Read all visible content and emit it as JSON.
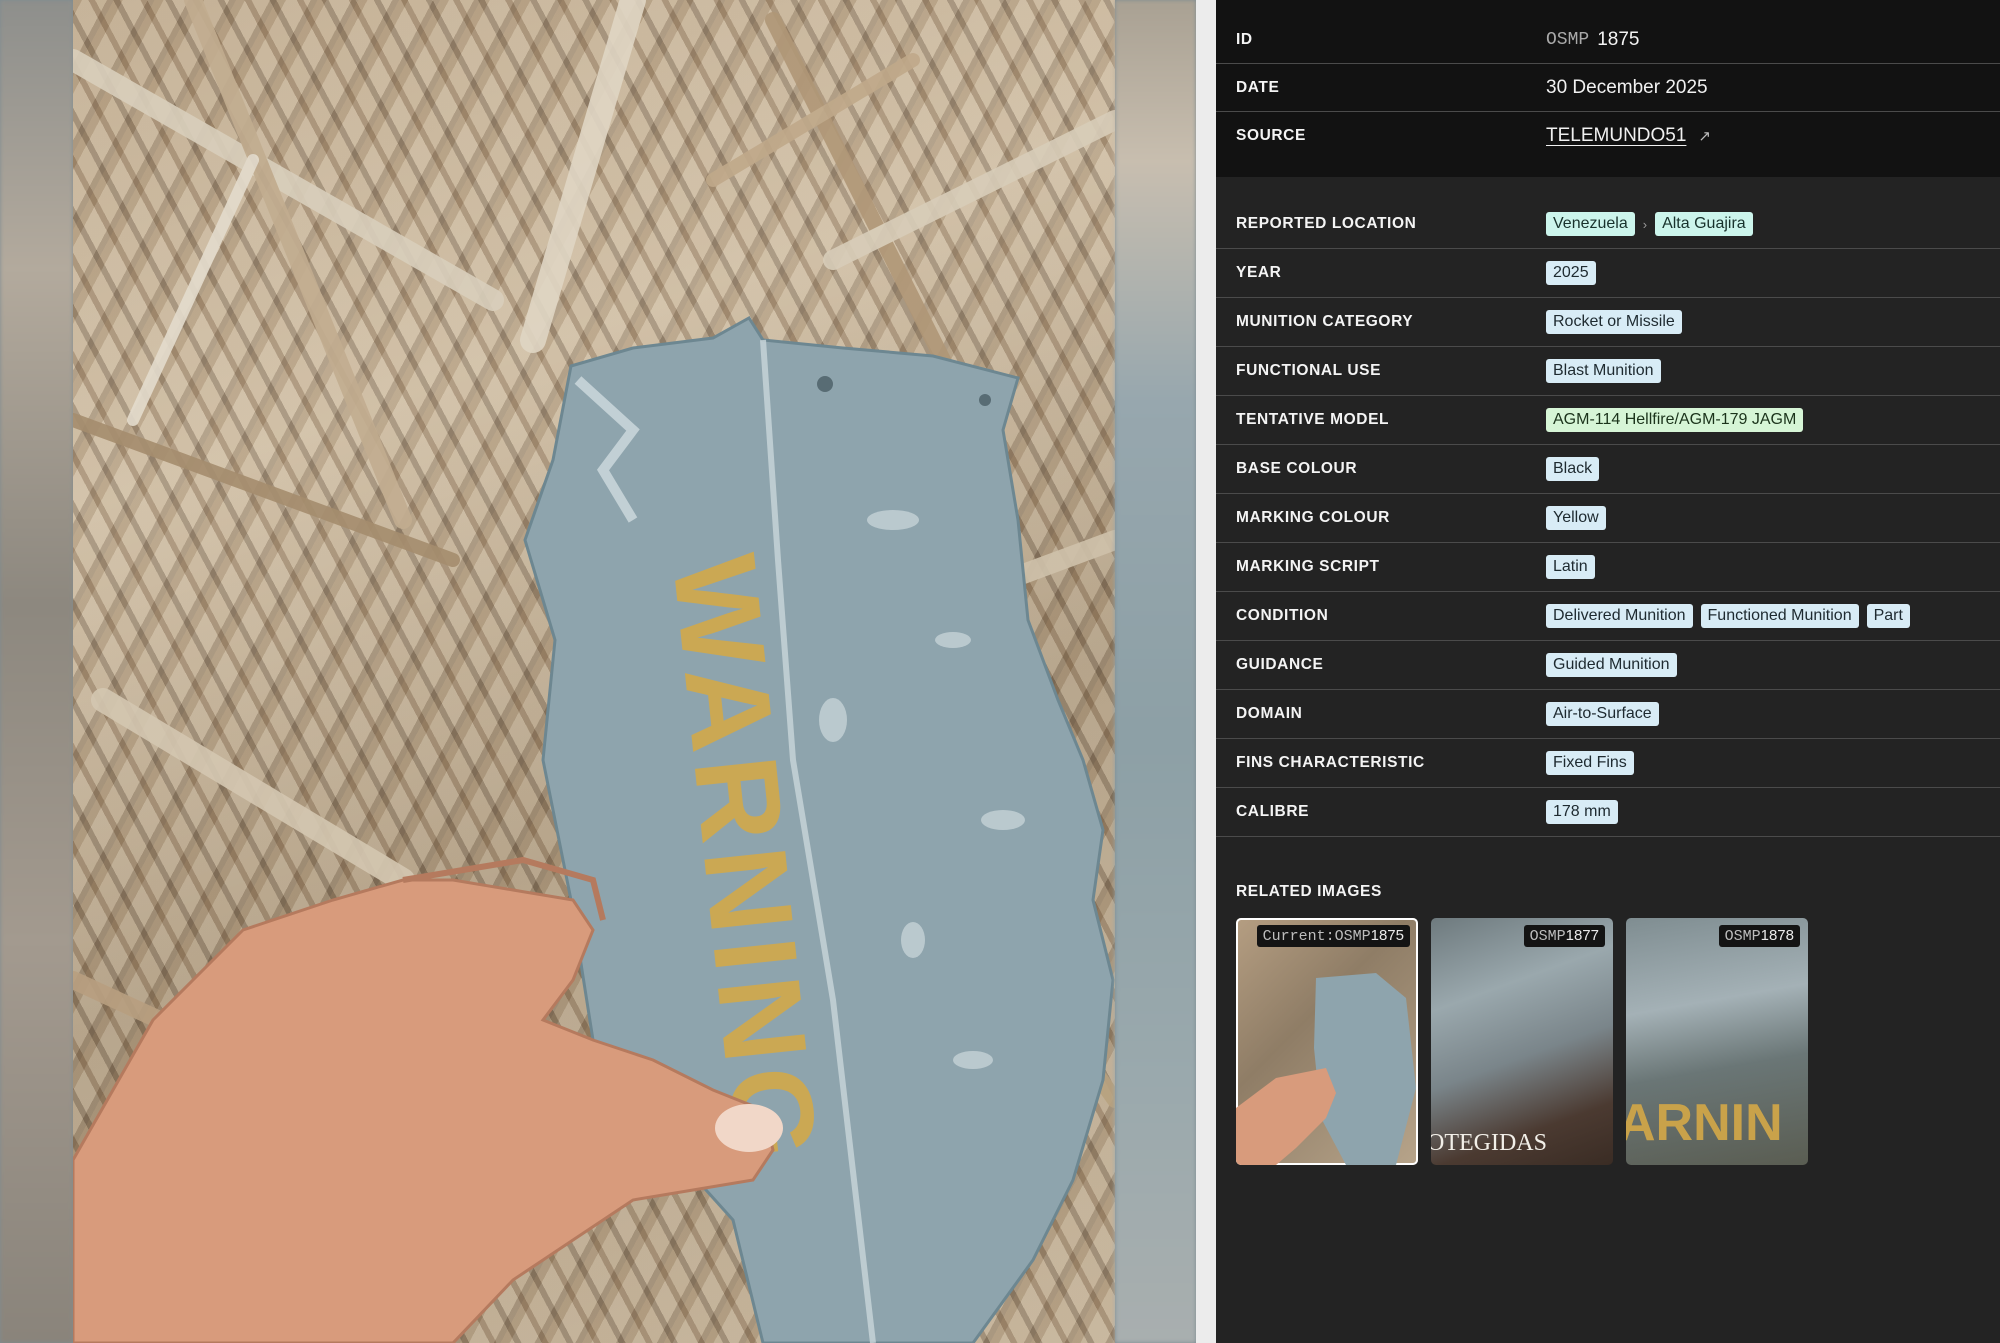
{
  "record": {
    "id_label": "ID",
    "id_prefix": "OSMP",
    "id_number": "1875",
    "date_label": "DATE",
    "date_value": "30 December 2025",
    "source_label": "SOURCE",
    "source_value": "TELEMUNDO51",
    "source_icon": "external-link-icon"
  },
  "photo": {
    "marking_text": "WARNING"
  },
  "attributes": {
    "reported_location": {
      "label": "REPORTED LOCATION",
      "tags": [
        "Venezuela",
        "Alta Guajira"
      ]
    },
    "year": {
      "label": "YEAR",
      "tags": [
        "2025"
      ]
    },
    "munition_category": {
      "label": "MUNITION CATEGORY",
      "tags": [
        "Rocket or Missile"
      ]
    },
    "functional_use": {
      "label": "FUNCTIONAL USE",
      "tags": [
        "Blast Munition"
      ]
    },
    "tentative_model": {
      "label": "TENTATIVE MODEL",
      "tags": [
        "AGM-114 Hellfire/AGM-179 JAGM"
      ]
    },
    "base_colour": {
      "label": "BASE COLOUR",
      "tags": [
        "Black"
      ]
    },
    "marking_colour": {
      "label": "MARKING COLOUR",
      "tags": [
        "Yellow"
      ]
    },
    "marking_script": {
      "label": "MARKING SCRIPT",
      "tags": [
        "Latin"
      ]
    },
    "condition": {
      "label": "CONDITION",
      "tags": [
        "Delivered Munition",
        "Functioned Munition",
        "Part"
      ]
    },
    "guidance": {
      "label": "GUIDANCE",
      "tags": [
        "Guided Munition"
      ]
    },
    "domain": {
      "label": "DOMAIN",
      "tags": [
        "Air-to-Surface"
      ]
    },
    "fins_characteristic": {
      "label": "FINS CHARACTERISTIC",
      "tags": [
        "Fixed Fins"
      ]
    },
    "calibre": {
      "label": "CALIBRE",
      "tags": [
        "178 mm"
      ]
    }
  },
  "related": {
    "title": "RELATED IMAGES",
    "items": [
      {
        "prefix": "Current:OSMP",
        "number": "1875",
        "caption": ""
      },
      {
        "prefix": "OSMP",
        "number": "1877",
        "caption": "OTEGIDAS"
      },
      {
        "prefix": "OSMP",
        "number": "1878",
        "caption": "ARNIN"
      }
    ]
  },
  "colors": {
    "panel_bg": "#232323",
    "panel_top_bg": "#121212",
    "tag_default": "#d8ecf6",
    "tag_location": "#ccf5ec",
    "tag_model": "#d6f5d6",
    "marking_yellow": "#d2a94a"
  }
}
